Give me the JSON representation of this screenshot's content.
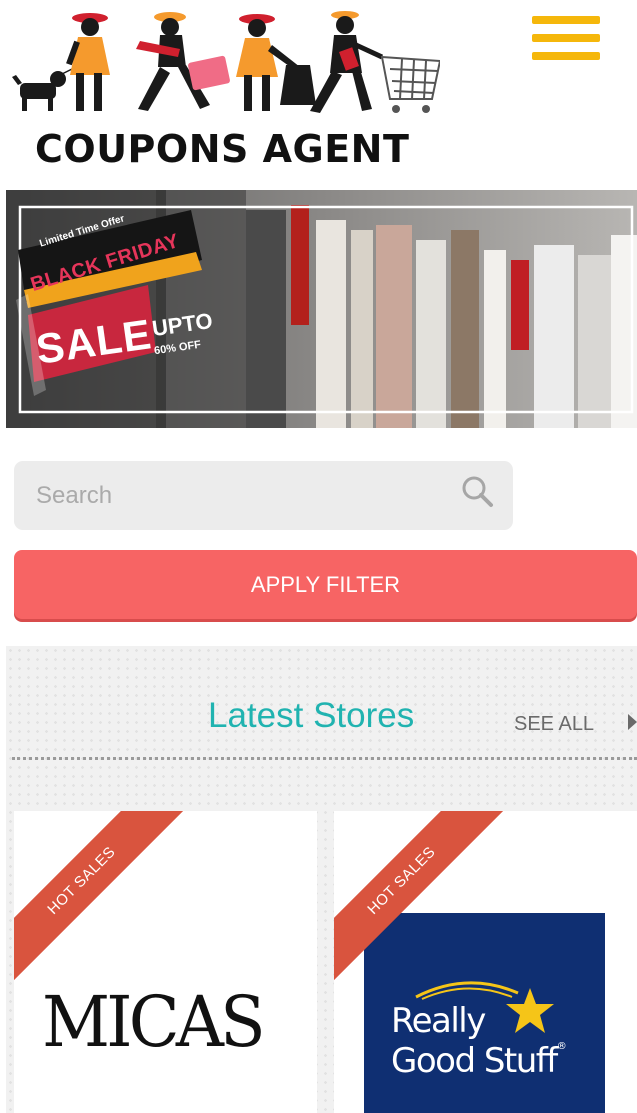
{
  "header": {
    "logo_text": "COUPONS AGENT",
    "menu_icon": "hamburger-menu-icon"
  },
  "banner": {
    "limited": "Limited Time Offer",
    "headline": "BLACK FRIDAY",
    "sale": "SALE",
    "upto": "UPTO",
    "off": "60% OFF"
  },
  "search": {
    "placeholder": "Search",
    "value": "",
    "icon": "search-icon"
  },
  "filter": {
    "apply_label": "APPLY FILTER"
  },
  "stores": {
    "title": "Latest Stores",
    "see_all": "SEE ALL",
    "items": [
      {
        "badge": "HOT SALES",
        "logo_text": "MICAS"
      },
      {
        "badge": "HOT SALES",
        "logo_line1": "Really",
        "logo_line2": "Good Stuff",
        "logo_mark": "®"
      }
    ]
  },
  "colors": {
    "accent_yellow": "#f5b70b",
    "apply_red": "#f76464",
    "title_teal": "#20b3b0",
    "ribbon": "#d9543e",
    "rgs_navy": "#0f2f72"
  }
}
